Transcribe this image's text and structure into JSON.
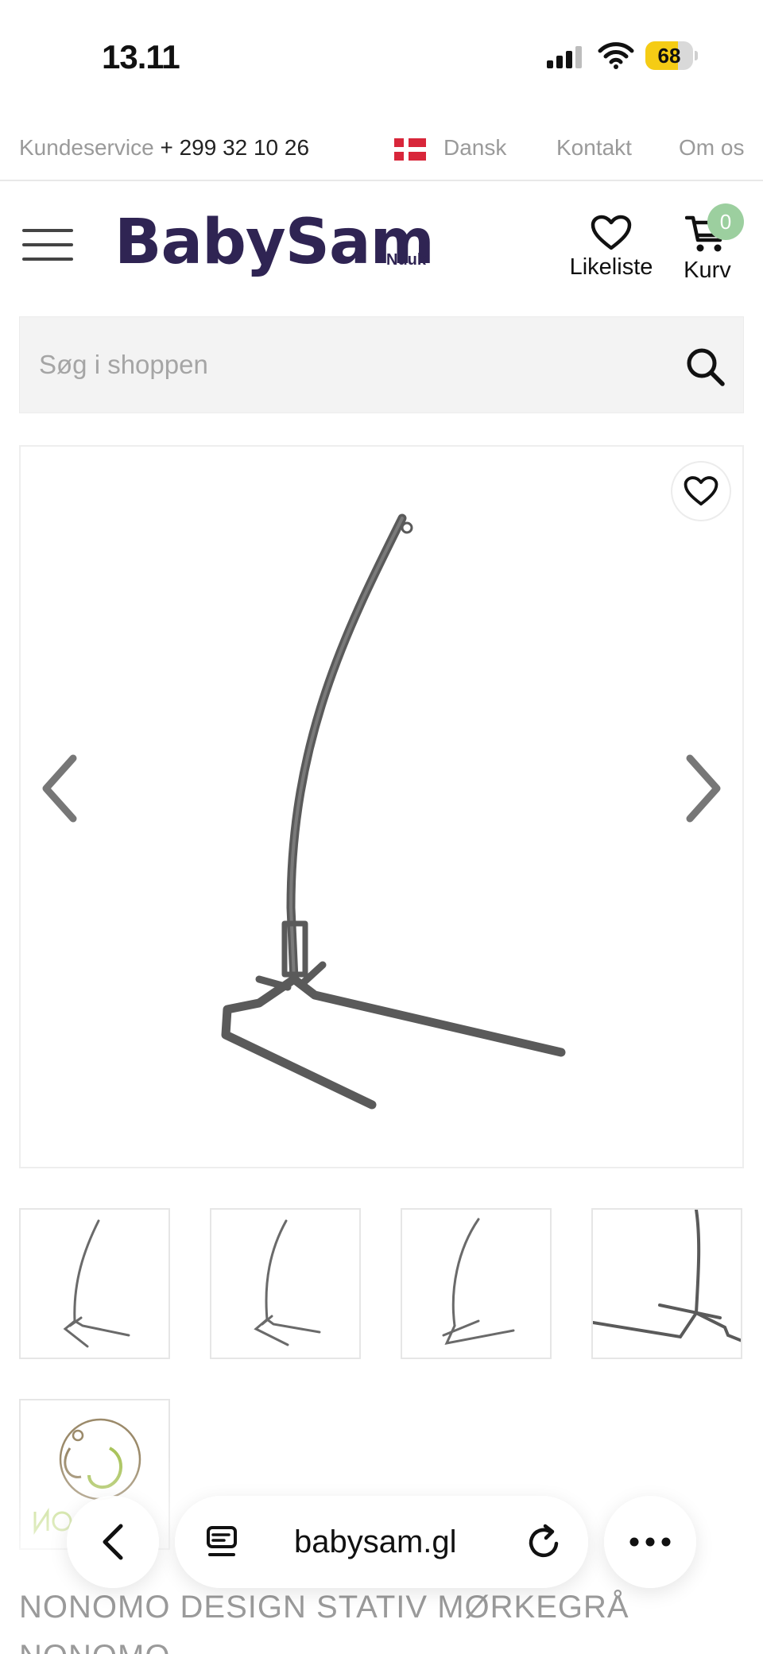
{
  "status_bar": {
    "time": "13.11",
    "battery": "68",
    "battery_fraction": 0.68,
    "icons": [
      "signal-icon",
      "wifi-icon",
      "battery-icon"
    ]
  },
  "topbar": {
    "customer_service_label": "Kundeservice",
    "phone": "+ 299 32 10 26",
    "language": "Dansk",
    "contact": "Kontakt",
    "about": "Om os"
  },
  "header": {
    "logo": "BabySam",
    "logo_location": "Nuuk",
    "wishlist_label": "Likeliste",
    "cart_label": "Kurv",
    "cart_count": "0"
  },
  "search": {
    "placeholder": "Søg i shoppen"
  },
  "product": {
    "title": "NONOMO DESIGN STATIV MØRKEGRÅ",
    "brand": "NONOMO"
  },
  "browser": {
    "url": "babysam.gl"
  },
  "colors": {
    "brand": "#2f2453",
    "badge": "#9ccf9f",
    "battery": "#f5cc15",
    "muted_text": "#9a9a9a"
  }
}
